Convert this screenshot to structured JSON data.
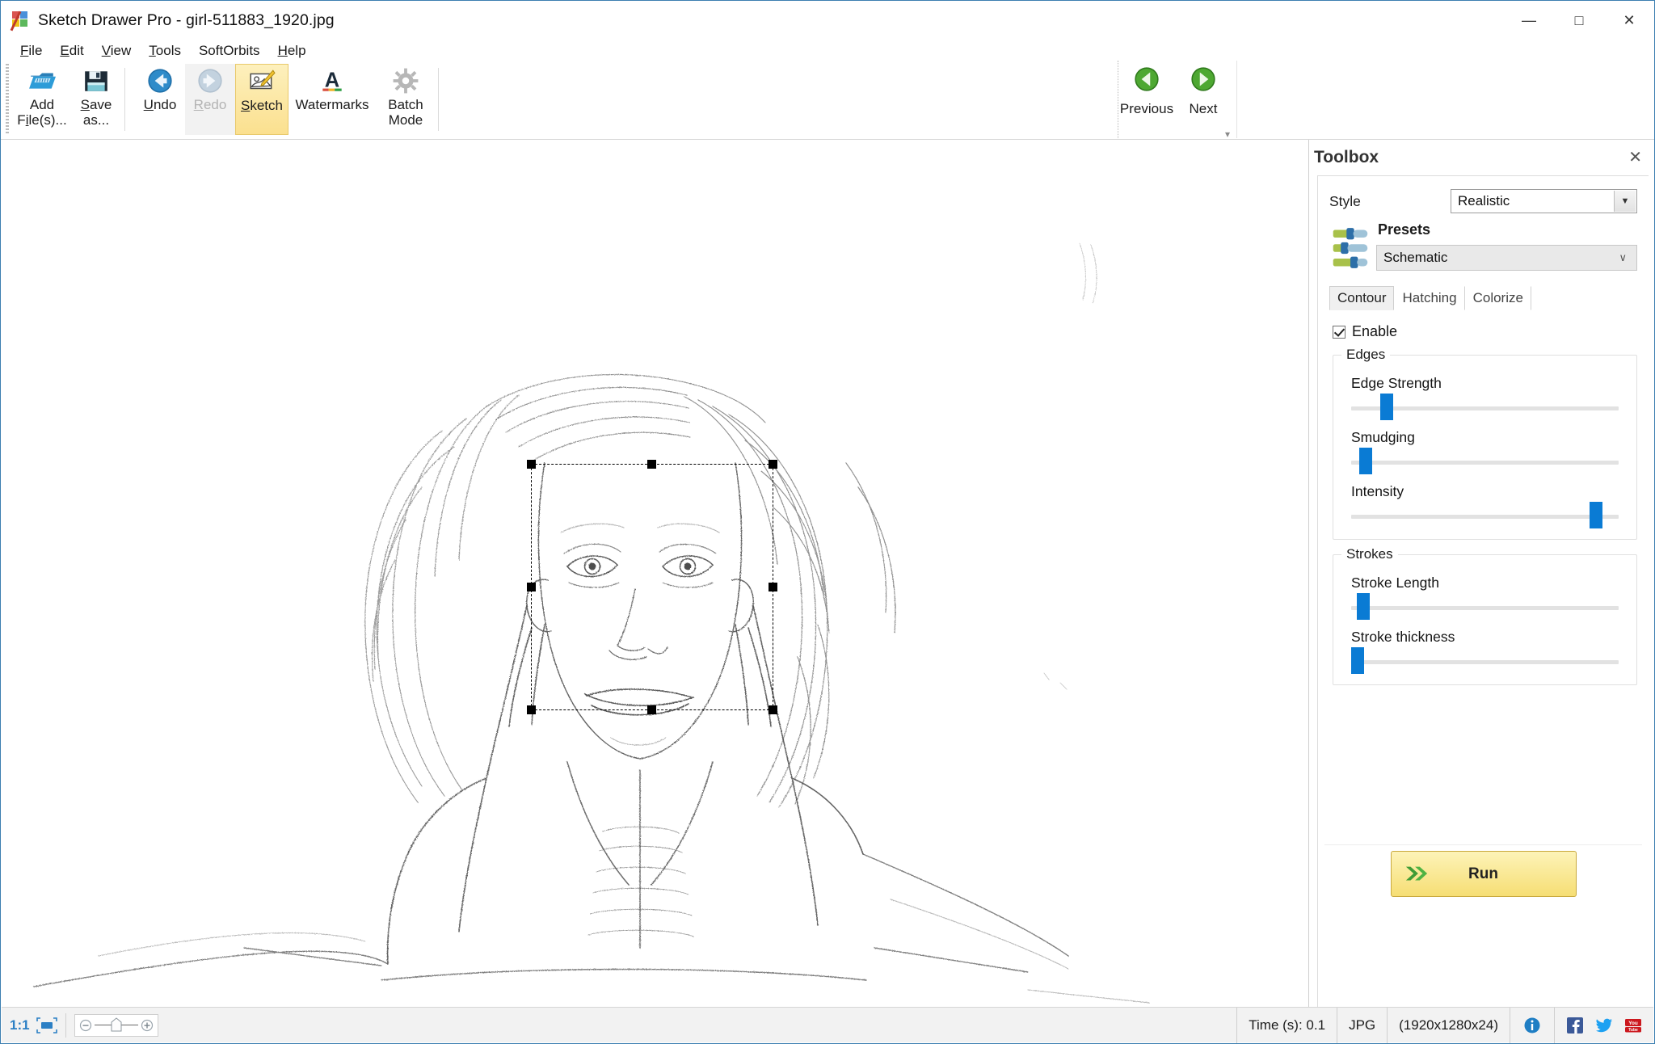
{
  "window": {
    "title": "Sketch Drawer Pro - girl-511883_1920.jpg",
    "app_icon": "sketch-drawer-icon",
    "minimize": "—",
    "maximize": "□",
    "close": "✕"
  },
  "menu": {
    "items": [
      {
        "label": "File",
        "mnemonic": "F"
      },
      {
        "label": "Edit",
        "mnemonic": "E"
      },
      {
        "label": "View",
        "mnemonic": "V"
      },
      {
        "label": "Tools",
        "mnemonic": "T"
      },
      {
        "label": "SoftOrbits",
        "mnemonic": ""
      },
      {
        "label": "Help",
        "mnemonic": "H"
      }
    ]
  },
  "toolbar": {
    "buttons": [
      {
        "label_line1": "Add",
        "label_line2": "File(s)...",
        "icon": "add-files-icon",
        "state": "normal"
      },
      {
        "label_line1": "Save",
        "label_line2": "as...",
        "icon": "save-as-icon",
        "state": "normal"
      },
      {
        "label_line1": "Undo",
        "label_line2": "",
        "icon": "undo-icon",
        "state": "normal"
      },
      {
        "label_line1": "Redo",
        "label_line2": "",
        "icon": "redo-icon",
        "state": "disabled"
      },
      {
        "label_line1": "Sketch",
        "label_line2": "",
        "icon": "sketch-icon",
        "state": "selected"
      },
      {
        "label_line1": "Watermarks",
        "label_line2": "",
        "icon": "watermarks-icon",
        "state": "normal"
      },
      {
        "label_line1": "Batch",
        "label_line2": "Mode",
        "icon": "batch-mode-icon",
        "state": "normal"
      }
    ],
    "nav": [
      {
        "label": "Previous",
        "icon": "previous-arrow-icon"
      },
      {
        "label": "Next",
        "icon": "next-arrow-icon"
      }
    ],
    "expand_glyph": "▾"
  },
  "toolbox": {
    "title": "Toolbox",
    "close_glyph": "✕",
    "style": {
      "label": "Style",
      "value": "Realistic",
      "arrow_glyph": "▼"
    },
    "presets": {
      "label": "Presets",
      "value": "Schematic",
      "chevron_glyph": "∨",
      "icon": "presets-sliders-icon"
    },
    "tabs": [
      {
        "label": "Contour",
        "active": true
      },
      {
        "label": "Hatching",
        "active": false
      },
      {
        "label": "Colorize",
        "active": false
      }
    ],
    "enable": {
      "label": "Enable",
      "checked": true
    },
    "groups": [
      {
        "title": "Edges",
        "sliders": [
          {
            "label": "Edge Strength",
            "percent": 12
          },
          {
            "label": "Smudging",
            "percent": 4
          },
          {
            "label": "Intensity",
            "percent": 91
          }
        ]
      },
      {
        "title": "Strokes",
        "sliders": [
          {
            "label": "Stroke Length",
            "percent": 3
          },
          {
            "label": "Stroke thickness",
            "percent": 1
          }
        ]
      }
    ],
    "run_button": {
      "label": "Run",
      "icon": "green-double-arrow-icon"
    }
  },
  "canvas": {
    "image_name": "girl-511883_1920.jpg",
    "selection": {
      "handles": 8,
      "style": "dashed"
    }
  },
  "statusbar": {
    "zoom_ratio": "1:1",
    "fit_icon": "fit-to-window-icon",
    "zoom_out_glyph": "−",
    "zoom_in_glyph": "+",
    "time": "Time (s): 0.1",
    "format": "JPG",
    "dimensions": "(1920x1280x24)",
    "info_icon": "info-icon",
    "facebook_icon": "facebook-icon",
    "twitter_icon": "twitter-icon",
    "youtube_icon": "youtube-icon"
  },
  "colors": {
    "accent_blue": "#0a7bd4",
    "selected_tab": "#fbe08f",
    "run_yellow": "#f6de74",
    "green_nav": "#3a9d35",
    "title_border": "#3c7fb1",
    "link_blue": "#2b7fc4"
  }
}
